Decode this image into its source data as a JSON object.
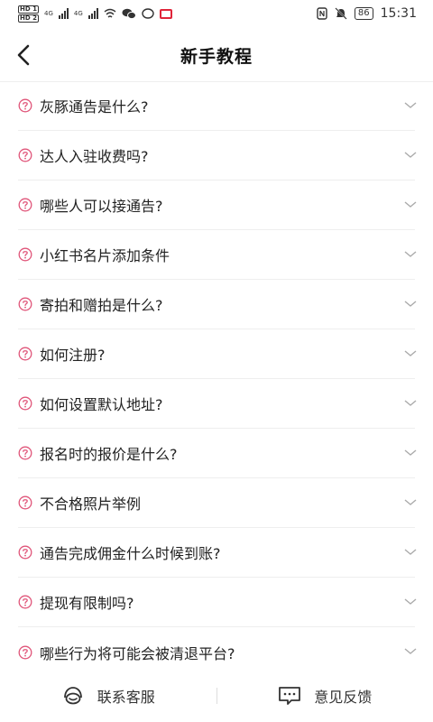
{
  "status_bar": {
    "left_badges": [
      "HD 1",
      "HD 2"
    ],
    "network_labels": [
      "4G",
      "4G"
    ],
    "battery": "86",
    "time": "15:31"
  },
  "header": {
    "title": "新手教程",
    "back_icon": "chevron-left-icon"
  },
  "faq": {
    "items": [
      {
        "question": "灰豚通告是什么?"
      },
      {
        "question": "达人入驻收费吗?"
      },
      {
        "question": "哪些人可以接通告?"
      },
      {
        "question": "小红书名片添加条件"
      },
      {
        "question": "寄拍和赠拍是什么?"
      },
      {
        "question": "如何注册?"
      },
      {
        "question": "如何设置默认地址?"
      },
      {
        "question": "报名时的报价是什么?"
      },
      {
        "question": "不合格照片举例"
      },
      {
        "question": "通告完成佣金什么时候到账?"
      },
      {
        "question": "提现有限制吗?"
      },
      {
        "question": "哪些行为将可能会被清退平台?"
      }
    ],
    "question_icon": "question-circle-icon",
    "expand_icon": "chevron-down-icon"
  },
  "bottom_bar": {
    "contact_label": "联系客服",
    "contact_icon": "headset-icon",
    "feedback_label": "意见反馈",
    "feedback_icon": "message-icon"
  },
  "colors": {
    "accent": "#e0567a",
    "divider": "#eeeeee",
    "text": "#222222"
  }
}
